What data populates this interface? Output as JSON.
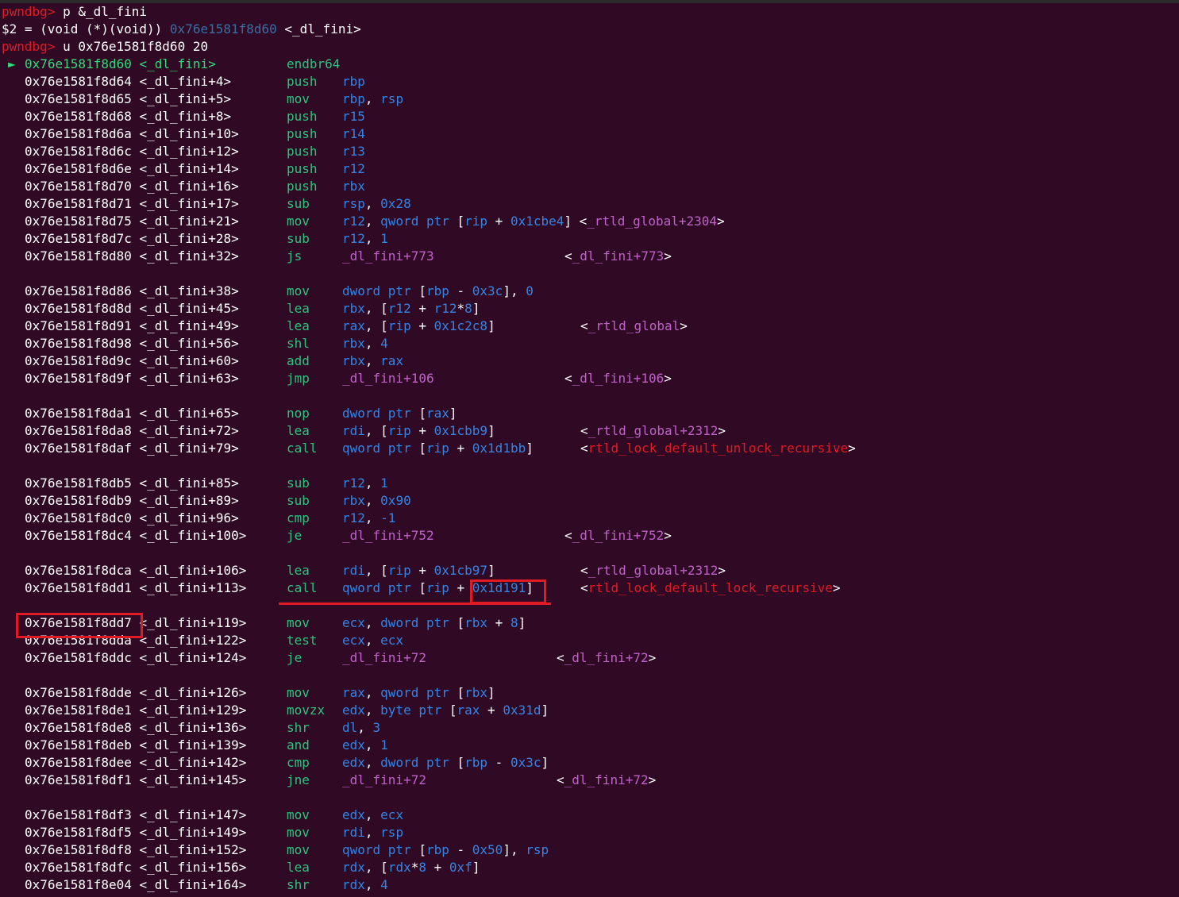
{
  "prompt": "pwndbg>",
  "commands": [
    {
      "text": " p &_dl_fini"
    },
    {
      "text": " u 0x76e1581f8d60 20"
    }
  ],
  "print_result": {
    "prefix": "$2 = (void (*)(void)) ",
    "address": "0x76e1581f8d60",
    "symbol": " <_dl_fini>"
  },
  "current_marker": "►",
  "rows": [
    {
      "addr": "0x76e1581f8d60",
      "sym": "<_dl_fini>",
      "mn": "endbr64",
      "ops": [],
      "cur": true
    },
    {
      "addr": "0x76e1581f8d64",
      "sym": "<_dl_fini+4>",
      "mn": "push",
      "ops": [
        [
          "reg",
          "rbp"
        ]
      ]
    },
    {
      "addr": "0x76e1581f8d65",
      "sym": "<_dl_fini+5>",
      "mn": "mov",
      "ops": [
        [
          "reg",
          "rbp"
        ],
        [
          "br",
          ", "
        ],
        [
          "reg",
          "rsp"
        ]
      ]
    },
    {
      "addr": "0x76e1581f8d68",
      "sym": "<_dl_fini+8>",
      "mn": "push",
      "ops": [
        [
          "reg",
          "r15"
        ]
      ]
    },
    {
      "addr": "0x76e1581f8d6a",
      "sym": "<_dl_fini+10>",
      "mn": "push",
      "ops": [
        [
          "reg",
          "r14"
        ]
      ]
    },
    {
      "addr": "0x76e1581f8d6c",
      "sym": "<_dl_fini+12>",
      "mn": "push",
      "ops": [
        [
          "reg",
          "r13"
        ]
      ]
    },
    {
      "addr": "0x76e1581f8d6e",
      "sym": "<_dl_fini+14>",
      "mn": "push",
      "ops": [
        [
          "reg",
          "r12"
        ]
      ]
    },
    {
      "addr": "0x76e1581f8d70",
      "sym": "<_dl_fini+16>",
      "mn": "push",
      "ops": [
        [
          "reg",
          "rbx"
        ]
      ]
    },
    {
      "addr": "0x76e1581f8d71",
      "sym": "<_dl_fini+17>",
      "mn": "sub",
      "ops": [
        [
          "reg",
          "rsp"
        ],
        [
          "br",
          ", "
        ],
        [
          "num",
          "0x28"
        ]
      ]
    },
    {
      "addr": "0x76e1581f8d75",
      "sym": "<_dl_fini+21>",
      "mn": "mov",
      "ops": [
        [
          "reg",
          "r12"
        ],
        [
          "br",
          ", "
        ],
        [
          "kw",
          "qword ptr "
        ],
        [
          "br",
          "["
        ],
        [
          "reg",
          "rip"
        ],
        [
          "br",
          " + "
        ],
        [
          "num",
          "0x1cbe4"
        ],
        [
          "br",
          "]"
        ]
      ],
      "cmt": [
        [
          "br",
          " <"
        ],
        [
          "sym",
          "_rtld_global+2304"
        ],
        [
          "br",
          ">"
        ]
      ]
    },
    {
      "addr": "0x76e1581f8d7c",
      "sym": "<_dl_fini+28>",
      "mn": "sub",
      "ops": [
        [
          "reg",
          "r12"
        ],
        [
          "br",
          ", "
        ],
        [
          "num",
          "1"
        ]
      ]
    },
    {
      "addr": "0x76e1581f8d80",
      "sym": "<_dl_fini+32>",
      "mn": "js",
      "ops": [
        [
          "jt",
          "_dl_fini+773"
        ]
      ],
      "cmt": [
        [
          "br",
          "<"
        ],
        [
          "jt",
          "_dl_fini+773"
        ],
        [
          "br",
          ">"
        ]
      ]
    },
    {
      "blank": true
    },
    {
      "addr": "0x76e1581f8d86",
      "sym": "<_dl_fini+38>",
      "mn": "mov",
      "ops": [
        [
          "kw",
          "dword ptr "
        ],
        [
          "br",
          "["
        ],
        [
          "reg",
          "rbp"
        ],
        [
          "br",
          " - "
        ],
        [
          "num",
          "0x3c"
        ],
        [
          "br",
          "], "
        ],
        [
          "num",
          "0"
        ]
      ]
    },
    {
      "addr": "0x76e1581f8d8d",
      "sym": "<_dl_fini+45>",
      "mn": "lea",
      "ops": [
        [
          "reg",
          "rbx"
        ],
        [
          "br",
          ", ["
        ],
        [
          "reg",
          "r12"
        ],
        [
          "br",
          " + "
        ],
        [
          "reg",
          "r12"
        ],
        [
          "br",
          "*"
        ],
        [
          "num",
          "8"
        ],
        [
          "br",
          "]"
        ]
      ]
    },
    {
      "addr": "0x76e1581f8d91",
      "sym": "<_dl_fini+49>",
      "mn": "lea",
      "ops": [
        [
          "reg",
          "rax"
        ],
        [
          "br",
          ", ["
        ],
        [
          "reg",
          "rip"
        ],
        [
          "br",
          " + "
        ],
        [
          "num",
          "0x1c2c8"
        ],
        [
          "br",
          "]"
        ]
      ],
      "cmt": [
        [
          "br",
          "<"
        ],
        [
          "sym",
          "_rtld_global"
        ],
        [
          "br",
          ">"
        ]
      ]
    },
    {
      "addr": "0x76e1581f8d98",
      "sym": "<_dl_fini+56>",
      "mn": "shl",
      "ops": [
        [
          "reg",
          "rbx"
        ],
        [
          "br",
          ", "
        ],
        [
          "num",
          "4"
        ]
      ]
    },
    {
      "addr": "0x76e1581f8d9c",
      "sym": "<_dl_fini+60>",
      "mn": "add",
      "ops": [
        [
          "reg",
          "rbx"
        ],
        [
          "br",
          ", "
        ],
        [
          "reg",
          "rax"
        ]
      ]
    },
    {
      "addr": "0x76e1581f8d9f",
      "sym": "<_dl_fini+63>",
      "mn": "jmp",
      "ops": [
        [
          "jt",
          "_dl_fini+106"
        ]
      ],
      "cmt": [
        [
          "br",
          "<"
        ],
        [
          "jt",
          "_dl_fini+106"
        ],
        [
          "br",
          ">"
        ]
      ]
    },
    {
      "blank": true
    },
    {
      "addr": "0x76e1581f8da1",
      "sym": "<_dl_fini+65>",
      "mn": "nop",
      "ops": [
        [
          "kw",
          "dword ptr "
        ],
        [
          "br",
          "["
        ],
        [
          "reg",
          "rax"
        ],
        [
          "br",
          "]"
        ]
      ]
    },
    {
      "addr": "0x76e1581f8da8",
      "sym": "<_dl_fini+72>",
      "mn": "lea",
      "ops": [
        [
          "reg",
          "rdi"
        ],
        [
          "br",
          ", ["
        ],
        [
          "reg",
          "rip"
        ],
        [
          "br",
          " + "
        ],
        [
          "num",
          "0x1cbb9"
        ],
        [
          "br",
          "]"
        ]
      ],
      "cmt": [
        [
          "br",
          "<"
        ],
        [
          "sym",
          "_rtld_global+2312"
        ],
        [
          "br",
          ">"
        ]
      ]
    },
    {
      "addr": "0x76e1581f8daf",
      "sym": "<_dl_fini+79>",
      "mn": "call",
      "ops": [
        [
          "kw",
          "qword ptr "
        ],
        [
          "br",
          "["
        ],
        [
          "reg",
          "rip"
        ],
        [
          "br",
          " + "
        ],
        [
          "num",
          "0x1d1bb"
        ],
        [
          "br",
          "]"
        ]
      ],
      "cmt": [
        [
          "br",
          "<"
        ],
        [
          "fn",
          "rtld_lock_default_unlock_recursive"
        ],
        [
          "br",
          ">"
        ]
      ]
    },
    {
      "blank": true
    },
    {
      "addr": "0x76e1581f8db5",
      "sym": "<_dl_fini+85>",
      "mn": "sub",
      "ops": [
        [
          "reg",
          "r12"
        ],
        [
          "br",
          ", "
        ],
        [
          "num",
          "1"
        ]
      ]
    },
    {
      "addr": "0x76e1581f8db9",
      "sym": "<_dl_fini+89>",
      "mn": "sub",
      "ops": [
        [
          "reg",
          "rbx"
        ],
        [
          "br",
          ", "
        ],
        [
          "num",
          "0x90"
        ]
      ]
    },
    {
      "addr": "0x76e1581f8dc0",
      "sym": "<_dl_fini+96>",
      "mn": "cmp",
      "ops": [
        [
          "reg",
          "r12"
        ],
        [
          "br",
          ", "
        ],
        [
          "num",
          "-1"
        ]
      ]
    },
    {
      "addr": "0x76e1581f8dc4",
      "sym": "<_dl_fini+100>",
      "mn": "je",
      "ops": [
        [
          "jt",
          "_dl_fini+752"
        ]
      ],
      "cmt": [
        [
          "br",
          "<"
        ],
        [
          "jt",
          "_dl_fini+752"
        ],
        [
          "br",
          ">"
        ]
      ]
    },
    {
      "blank": true
    },
    {
      "addr": "0x76e1581f8dca",
      "sym": "<_dl_fini+106>",
      "mn": "lea",
      "ops": [
        [
          "reg",
          "rdi"
        ],
        [
          "br",
          ", ["
        ],
        [
          "reg",
          "rip"
        ],
        [
          "br",
          " + "
        ],
        [
          "num",
          "0x1cb97"
        ],
        [
          "br",
          "]"
        ]
      ],
      "cmt": [
        [
          "br",
          "<"
        ],
        [
          "sym",
          "_rtld_global+2312"
        ],
        [
          "br",
          ">"
        ]
      ]
    },
    {
      "addr": "0x76e1581f8dd1",
      "sym": "<_dl_fini+113>",
      "mn": "call",
      "ops": [
        [
          "kw",
          "qword ptr "
        ],
        [
          "br",
          "["
        ],
        [
          "reg",
          "rip"
        ],
        [
          "br",
          " + "
        ],
        [
          "num",
          "0x1d191"
        ],
        [
          "br",
          "]"
        ]
      ],
      "cmt": [
        [
          "br",
          "<"
        ],
        [
          "fn",
          "rtld_lock_default_lock_recursive"
        ],
        [
          "br",
          ">"
        ]
      ]
    },
    {
      "blank": true
    },
    {
      "addr": "0x76e1581f8dd7",
      "sym": "<_dl_fini+119>",
      "mn": "mov",
      "ops": [
        [
          "reg",
          "ecx"
        ],
        [
          "br",
          ", "
        ],
        [
          "kw",
          "dword ptr "
        ],
        [
          "br",
          "["
        ],
        [
          "reg",
          "rbx"
        ],
        [
          "br",
          " + "
        ],
        [
          "num",
          "8"
        ],
        [
          "br",
          "]"
        ]
      ]
    },
    {
      "addr": "0x76e1581f8dda",
      "sym": "<_dl_fini+122>",
      "mn": "test",
      "ops": [
        [
          "reg",
          "ecx"
        ],
        [
          "br",
          ", "
        ],
        [
          "reg",
          "ecx"
        ]
      ]
    },
    {
      "addr": "0x76e1581f8ddc",
      "sym": "<_dl_fini+124>",
      "mn": "je",
      "ops": [
        [
          "jt",
          "_dl_fini+72"
        ]
      ],
      "cmt": [
        [
          "br",
          "<"
        ],
        [
          "jt",
          "_dl_fini+72"
        ],
        [
          "br",
          ">"
        ]
      ]
    },
    {
      "blank": true
    },
    {
      "addr": "0x76e1581f8dde",
      "sym": "<_dl_fini+126>",
      "mn": "mov",
      "ops": [
        [
          "reg",
          "rax"
        ],
        [
          "br",
          ", "
        ],
        [
          "kw",
          "qword ptr "
        ],
        [
          "br",
          "["
        ],
        [
          "reg",
          "rbx"
        ],
        [
          "br",
          "]"
        ]
      ]
    },
    {
      "addr": "0x76e1581f8de1",
      "sym": "<_dl_fini+129>",
      "mn": "movzx",
      "ops": [
        [
          "reg",
          "edx"
        ],
        [
          "br",
          ", "
        ],
        [
          "kw",
          "byte ptr "
        ],
        [
          "br",
          "["
        ],
        [
          "reg",
          "rax"
        ],
        [
          "br",
          " + "
        ],
        [
          "num",
          "0x31d"
        ],
        [
          "br",
          "]"
        ]
      ]
    },
    {
      "addr": "0x76e1581f8de8",
      "sym": "<_dl_fini+136>",
      "mn": "shr",
      "ops": [
        [
          "reg",
          "dl"
        ],
        [
          "br",
          ", "
        ],
        [
          "num",
          "3"
        ]
      ]
    },
    {
      "addr": "0x76e1581f8deb",
      "sym": "<_dl_fini+139>",
      "mn": "and",
      "ops": [
        [
          "reg",
          "edx"
        ],
        [
          "br",
          ", "
        ],
        [
          "num",
          "1"
        ]
      ]
    },
    {
      "addr": "0x76e1581f8dee",
      "sym": "<_dl_fini+142>",
      "mn": "cmp",
      "ops": [
        [
          "reg",
          "edx"
        ],
        [
          "br",
          ", "
        ],
        [
          "kw",
          "dword ptr "
        ],
        [
          "br",
          "["
        ],
        [
          "reg",
          "rbp"
        ],
        [
          "br",
          " - "
        ],
        [
          "num",
          "0x3c"
        ],
        [
          "br",
          "]"
        ]
      ]
    },
    {
      "addr": "0x76e1581f8df1",
      "sym": "<_dl_fini+145>",
      "mn": "jne",
      "ops": [
        [
          "jt",
          "_dl_fini+72"
        ]
      ],
      "cmt": [
        [
          "br",
          "<"
        ],
        [
          "jt",
          "_dl_fini+72"
        ],
        [
          "br",
          ">"
        ]
      ]
    },
    {
      "blank": true
    },
    {
      "addr": "0x76e1581f8df3",
      "sym": "<_dl_fini+147>",
      "mn": "mov",
      "ops": [
        [
          "reg",
          "edx"
        ],
        [
          "br",
          ", "
        ],
        [
          "reg",
          "ecx"
        ]
      ]
    },
    {
      "addr": "0x76e1581f8df5",
      "sym": "<_dl_fini+149>",
      "mn": "mov",
      "ops": [
        [
          "reg",
          "rdi"
        ],
        [
          "br",
          ", "
        ],
        [
          "reg",
          "rsp"
        ]
      ]
    },
    {
      "addr": "0x76e1581f8df8",
      "sym": "<_dl_fini+152>",
      "mn": "mov",
      "ops": [
        [
          "kw",
          "qword ptr "
        ],
        [
          "br",
          "["
        ],
        [
          "reg",
          "rbp"
        ],
        [
          "br",
          " - "
        ],
        [
          "num",
          "0x50"
        ],
        [
          "br",
          "], "
        ],
        [
          "reg",
          "rsp"
        ]
      ]
    },
    {
      "addr": "0x76e1581f8dfc",
      "sym": "<_dl_fini+156>",
      "mn": "lea",
      "ops": [
        [
          "reg",
          "rdx"
        ],
        [
          "br",
          ", ["
        ],
        [
          "reg",
          "rdx"
        ],
        [
          "br",
          "*"
        ],
        [
          "num",
          "8"
        ],
        [
          "br",
          " + "
        ],
        [
          "num",
          "0xf"
        ],
        [
          "br",
          "]"
        ]
      ]
    },
    {
      "addr": "0x76e1581f8e04",
      "sym": "<_dl_fini+164>",
      "mn": "shr",
      "ops": [
        [
          "reg",
          "rdx"
        ],
        [
          "br",
          ", "
        ],
        [
          "num",
          "4"
        ]
      ]
    }
  ]
}
